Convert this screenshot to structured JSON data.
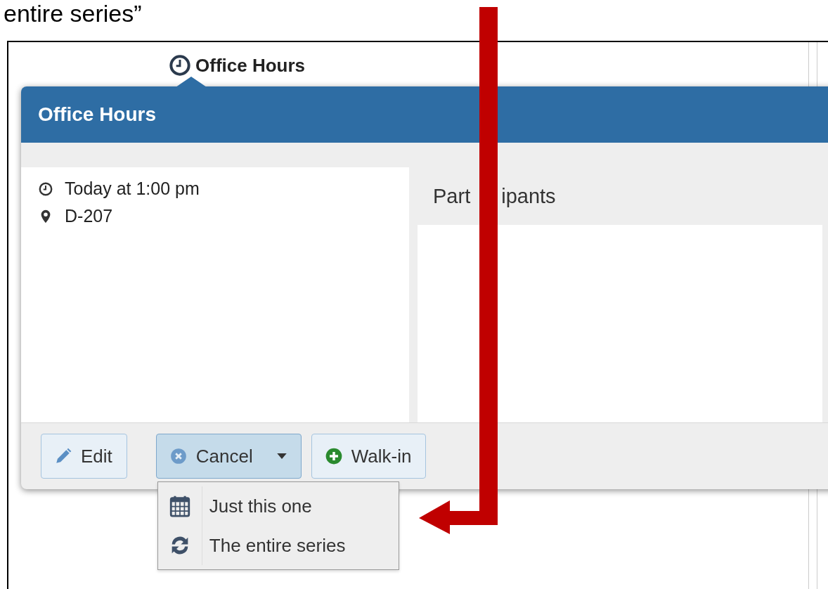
{
  "caption": "entire series”",
  "event_label": {
    "title": "Office Hours"
  },
  "popover": {
    "title": "Office Hours",
    "details": [
      {
        "kind": "time",
        "text": "Today at 1:00 pm"
      },
      {
        "kind": "location",
        "text": "D-207"
      }
    ],
    "participants_heading": [
      "Part",
      "ipants"
    ],
    "actions": [
      {
        "kind": "edit",
        "label": "Edit",
        "selected": false,
        "dropdown": false
      },
      {
        "kind": "cancel",
        "label": "Cancel",
        "selected": true,
        "dropdown": true
      },
      {
        "kind": "walkin",
        "label": "Walk-in",
        "selected": false,
        "dropdown": false
      }
    ],
    "menu": {
      "items": [
        {
          "kind": "single",
          "label": "Just this one"
        },
        {
          "kind": "series",
          "label": "The entire series"
        }
      ]
    }
  }
}
